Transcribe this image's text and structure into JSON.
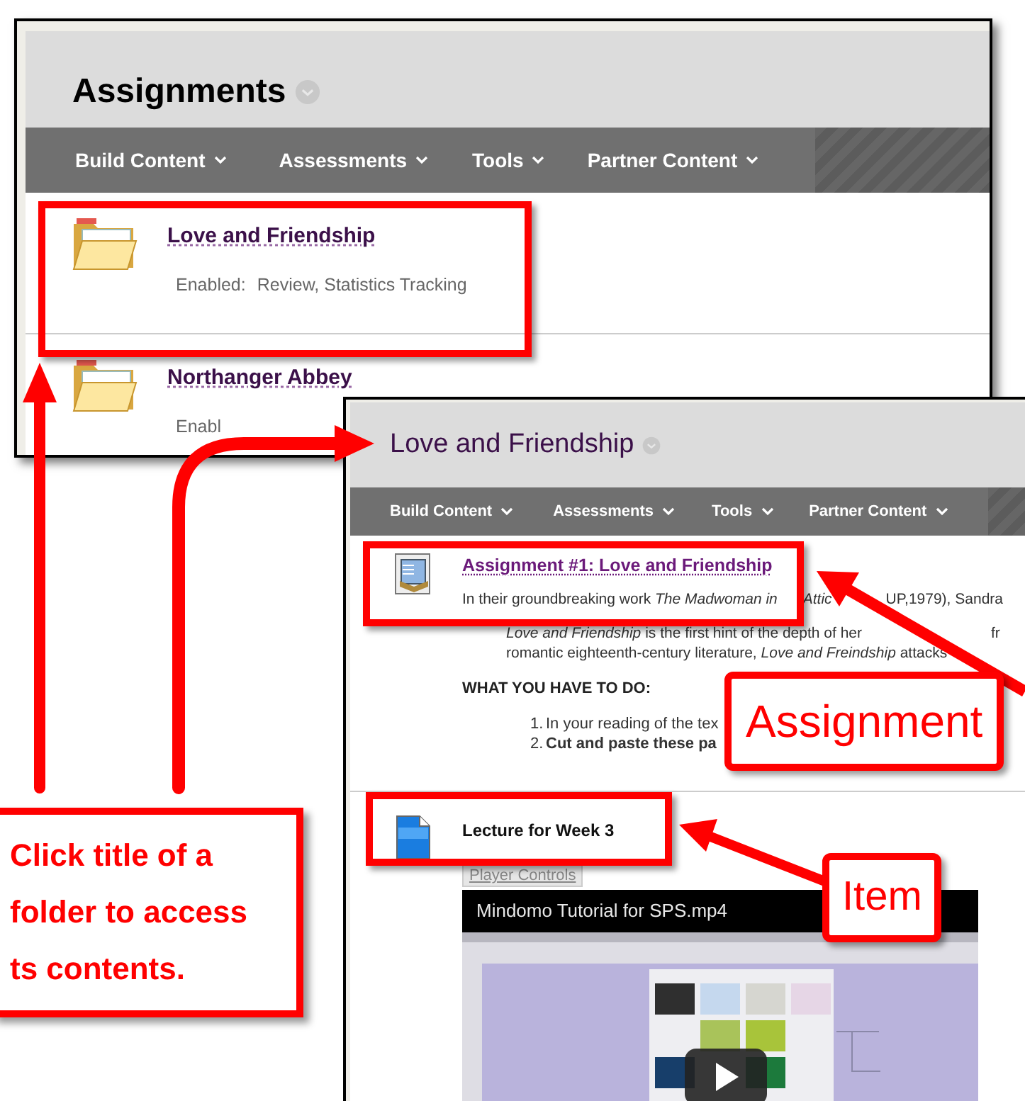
{
  "background_window": {
    "title": "Assignments",
    "menu": [
      "Build Content",
      "Assessments",
      "Tools",
      "Partner Content"
    ],
    "items": [
      {
        "title": "Love and Friendship",
        "label": "Enabled:",
        "detail": "Review, Statistics Tracking"
      },
      {
        "title": "Northanger Abbey",
        "label": "Enabl"
      }
    ]
  },
  "foreground_window": {
    "title": "Love and Friendship",
    "menu": [
      "Build Content",
      "Assessments",
      "Tools",
      "Partner Content"
    ],
    "content": [
      {
        "kind": "assignment",
        "title": "Assignment #1: Love and Friendship",
        "description": [
          "In their groundbreaking work *The Madwoman in*",
          "*Attic*",
          "UP,1979), Sandra"
        ],
        "quote": [
          [
            "*Love and Friendship* is the first hint of the depth of her",
            "fr"
          ],
          [
            "romantic eighteenth-century literature, *Love and Freindship* attacks"
          ]
        ],
        "heading": "WHAT YOU HAVE TO DO:",
        "steps": [
          {
            "number": "1.",
            "text": "In your reading of the tex",
            "bold": false
          },
          {
            "number": "2.",
            "text": "Cut and paste these pa",
            "bold": true
          }
        ]
      },
      {
        "kind": "item",
        "title": "Lecture for Week 3",
        "button": "Player Controls",
        "video": {
          "title": "Mindomo Tutorial for SPS.mp4"
        }
      }
    ]
  },
  "callouts": [
    {
      "kind": "note",
      "lines": [
        "Click title of a",
        "folder to access",
        "ts contents."
      ]
    },
    {
      "kind": "tag",
      "text": "Assignment"
    },
    {
      "kind": "tag",
      "text": "Item"
    }
  ]
}
